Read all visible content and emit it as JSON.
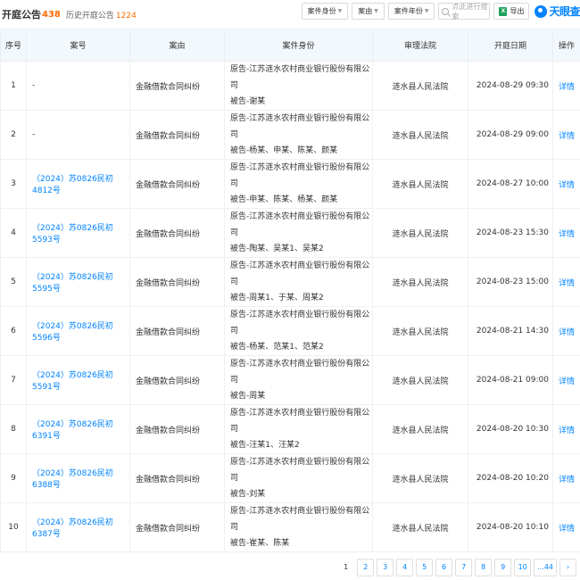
{
  "header": {
    "title": "开庭公告",
    "count": "438",
    "history_label": "历史开庭公告",
    "history_count": "1224"
  },
  "filters": {
    "identity": "案件身份",
    "reason": "案由",
    "year": "案件年份",
    "search_placeholder": "点此进行搜索",
    "export": "导出",
    "logo": "天眼查"
  },
  "columns": [
    "序号",
    "案号",
    "案由",
    "案件身份",
    "审理法院",
    "开庭日期",
    "操作"
  ],
  "rows": [
    {
      "idx": "1",
      "case_no": "-",
      "reason": "金融借款合同纠纷",
      "plaintiff": "原告-江苏涟水农村商业银行股份有限公司",
      "defendant": "被告-谢某",
      "court": "涟水县人民法院",
      "date": "2024-08-29 09:30",
      "op": "详情"
    },
    {
      "idx": "2",
      "case_no": "-",
      "reason": "金融借款合同纠纷",
      "plaintiff": "原告-江苏涟水农村商业银行股份有限公司",
      "defendant": "被告-杨某、申某、陈某、颜某",
      "court": "涟水县人民法院",
      "date": "2024-08-29 09:00",
      "op": "详情"
    },
    {
      "idx": "3",
      "case_no": "（2024）苏0826民初4812号",
      "reason": "金融借款合同纠纷",
      "plaintiff": "原告-江苏涟水农村商业银行股份有限公司",
      "defendant": "被告-申某、陈某、杨某、颜某",
      "court": "涟水县人民法院",
      "date": "2024-08-27 10:00",
      "op": "详情"
    },
    {
      "idx": "4",
      "case_no": "（2024）苏0826民初5593号",
      "reason": "金融借款合同纠纷",
      "plaintiff": "原告-江苏涟水农村商业银行股份有限公司",
      "defendant": "被告-陶某、吴某1、吴某2",
      "court": "涟水县人民法院",
      "date": "2024-08-23 15:30",
      "op": "详情"
    },
    {
      "idx": "5",
      "case_no": "（2024）苏0826民初5595号",
      "reason": "金融借款合同纠纷",
      "plaintiff": "原告-江苏涟水农村商业银行股份有限公司",
      "defendant": "被告-周某1、于某、周某2",
      "court": "涟水县人民法院",
      "date": "2024-08-23 15:00",
      "op": "详情"
    },
    {
      "idx": "6",
      "case_no": "（2024）苏0826民初5596号",
      "reason": "金融借款合同纠纷",
      "plaintiff": "原告-江苏涟水农村商业银行股份有限公司",
      "defendant": "被告-杨某、范某1、范某2",
      "court": "涟水县人民法院",
      "date": "2024-08-21 14:30",
      "op": "详情"
    },
    {
      "idx": "7",
      "case_no": "（2024）苏0826民初5591号",
      "reason": "金融借款合同纠纷",
      "plaintiff": "原告-江苏涟水农村商业银行股份有限公司",
      "defendant": "被告-周某",
      "court": "涟水县人民法院",
      "date": "2024-08-21 09:00",
      "op": "详情"
    },
    {
      "idx": "8",
      "case_no": "（2024）苏0826民初6391号",
      "reason": "金融借款合同纠纷",
      "plaintiff": "原告-江苏涟水农村商业银行股份有限公司",
      "defendant": "被告-汪某1、汪某2",
      "court": "涟水县人民法院",
      "date": "2024-08-20 10:30",
      "op": "详情"
    },
    {
      "idx": "9",
      "case_no": "（2024）苏0826民初6388号",
      "reason": "金融借款合同纠纷",
      "plaintiff": "原告-江苏涟水农村商业银行股份有限公司",
      "defendant": "被告-刘某",
      "court": "涟水县人民法院",
      "date": "2024-08-20 10:20",
      "op": "详情"
    },
    {
      "idx": "10",
      "case_no": "（2024）苏0826民初6387号",
      "reason": "金融借款合同纠纷",
      "plaintiff": "原告-江苏涟水农村商业银行股份有限公司",
      "defendant": "被告-崔某、陈某",
      "court": "涟水县人民法院",
      "date": "2024-08-20 10:10",
      "op": "详情"
    }
  ],
  "pagination": {
    "current": "1",
    "pages": [
      "2",
      "3",
      "4",
      "5",
      "6",
      "7",
      "8",
      "9",
      "10"
    ],
    "last": "...44",
    "next": "›"
  }
}
